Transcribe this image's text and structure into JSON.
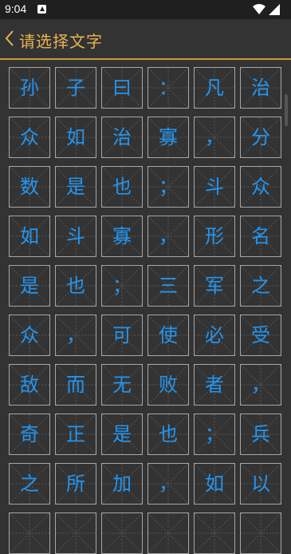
{
  "status_bar": {
    "time": "9:04"
  },
  "app_bar": {
    "title": "请选择文字"
  },
  "grid": {
    "cells": [
      "孙",
      "子",
      "曰",
      "：",
      "凡",
      "治",
      "众",
      "如",
      "治",
      "寡",
      "，",
      "分",
      "数",
      "是",
      "也",
      "；",
      "斗",
      "众",
      "如",
      "斗",
      "寡",
      "，",
      "形",
      "名",
      "是",
      "也",
      "；",
      "三",
      "军",
      "之",
      "众",
      "，",
      "可",
      "使",
      "必",
      "受",
      "敌",
      "而",
      "无",
      "败",
      "者",
      "，",
      "奇",
      "正",
      "是",
      "也",
      "；",
      "兵",
      "之",
      "所",
      "加",
      "，",
      "如",
      "以",
      "",
      "",
      "",
      "",
      "",
      ""
    ]
  },
  "colors": {
    "accent": "#e7b451",
    "character": "#2196f3",
    "background": "#333333"
  }
}
